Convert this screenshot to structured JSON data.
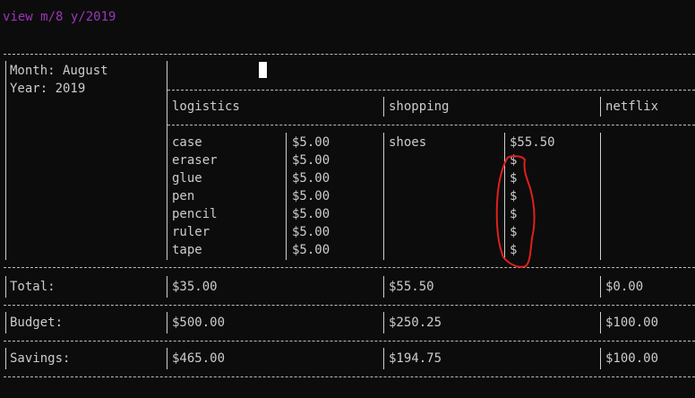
{
  "command": "view m/8 y/2019",
  "period": {
    "month_label": "Month: August",
    "year_label": "Year: 2019"
  },
  "categories": [
    {
      "name": "logistics",
      "items": [
        {
          "name": "case",
          "price": "$5.00"
        },
        {
          "name": "eraser",
          "price": "$5.00"
        },
        {
          "name": "glue",
          "price": "$5.00"
        },
        {
          "name": "pen",
          "price": "$5.00"
        },
        {
          "name": "pencil",
          "price": "$5.00"
        },
        {
          "name": "ruler",
          "price": "$5.00"
        },
        {
          "name": "tape",
          "price": "$5.00"
        }
      ],
      "total": "$35.00",
      "budget": "$500.00",
      "savings": "$465.00"
    },
    {
      "name": "shopping",
      "items": [
        {
          "name": "shoes",
          "price": "$55.50"
        },
        {
          "name": "",
          "price": "$"
        },
        {
          "name": "",
          "price": "$"
        },
        {
          "name": "",
          "price": "$"
        },
        {
          "name": "",
          "price": "$"
        },
        {
          "name": "",
          "price": "$"
        },
        {
          "name": "",
          "price": "$"
        }
      ],
      "total": "$55.50",
      "budget": "$250.25",
      "savings": "$194.75"
    },
    {
      "name": "netflix",
      "items": [],
      "total": "$0.00",
      "budget": "$100.00",
      "savings": "$100.00"
    }
  ],
  "labels": {
    "total": "Total:",
    "budget": "Budget:",
    "savings": "Savings:"
  },
  "annotation_color": "#e0201c"
}
